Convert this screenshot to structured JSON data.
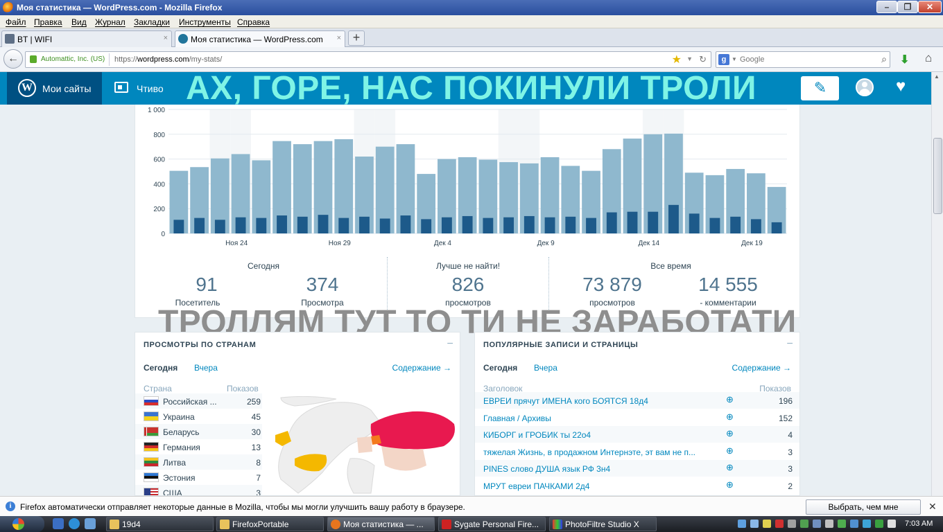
{
  "window": {
    "title": "Моя статистика — WordPress.com - Mozilla Firefox"
  },
  "menu": [
    "Файл",
    "Правка",
    "Вид",
    "Журнал",
    "Закладки",
    "Инструменты",
    "Справка"
  ],
  "tabs": [
    {
      "label": "BT | WIFI",
      "close": "×"
    },
    {
      "label": "Моя статистика — WordPress.com",
      "close": "×"
    }
  ],
  "newtab": "+",
  "address": {
    "identity": "Automattic, Inc. (US)",
    "url_prefix": "https://",
    "url_domain": "wordpress.com",
    "url_path": "/my-stats/"
  },
  "search": {
    "engine": "g",
    "placeholder": "Google"
  },
  "masterbar": {
    "my_sites": "Мои сайты",
    "reader": "Чтиво",
    "banner": "АХ, ГОРЕ, НАС ПОКИНУЛИ ТРОЛИ",
    "accent": "#0087be",
    "banner_color": "#7ff4e6"
  },
  "chart_data": {
    "type": "bar",
    "y_ticks": [
      "1 000",
      "800",
      "600",
      "400",
      "200",
      "0"
    ],
    "ylim": [
      0,
      1000
    ],
    "x_tick_labels": [
      "Ноя 24",
      "Ноя 29",
      "Дек 4",
      "Дек 9",
      "Дек 14",
      "Дек 19"
    ],
    "x_tick_index": [
      4,
      9,
      14,
      19,
      24,
      29
    ],
    "weekend_index": [
      2,
      3,
      9,
      10,
      16,
      17,
      23,
      24
    ],
    "series": [
      {
        "color": "#8fb8ce",
        "values": [
          505,
          535,
          605,
          640,
          590,
          745,
          720,
          745,
          760,
          620,
          700,
          720,
          480,
          600,
          615,
          595,
          575,
          565,
          615,
          545,
          505,
          680,
          765,
          800,
          805,
          490,
          470,
          520,
          485,
          375
        ]
      },
      {
        "color": "#1d5a8a",
        "values": [
          110,
          125,
          110,
          130,
          125,
          145,
          135,
          150,
          125,
          135,
          120,
          145,
          115,
          130,
          140,
          125,
          130,
          140,
          130,
          135,
          125,
          170,
          175,
          175,
          230,
          160,
          125,
          135,
          115,
          90
        ]
      }
    ]
  },
  "summary": {
    "today": {
      "heading": "Сегодня",
      "visitors": "91",
      "visitors_label": "Посетитель",
      "views": "374",
      "views_label": "Просмотра"
    },
    "best": {
      "heading": "Лучше не найти!",
      "views": "826",
      "views_label": "просмотров"
    },
    "all_time": {
      "heading": "Все время",
      "views": "73 879",
      "views_label": "просмотров",
      "comments": "14 555",
      "comments_label": "- комментарии"
    }
  },
  "troll_banner": "ТРОЛЛЯМ ТУТ ТО ТИ НЕ ЗАРАБОТАТИ",
  "countries": {
    "title": "ПРОСМОТРЫ ПО СТРАНАМ",
    "minimize": "–",
    "tab_today": "Сегодня",
    "tab_yesterday": "Вчера",
    "contents": "Содержание →",
    "col_country": "Страна",
    "col_views": "Показов",
    "rows": [
      {
        "name": "Российская ...",
        "views": "259"
      },
      {
        "name": "Украина",
        "views": "45"
      },
      {
        "name": "Беларусь",
        "views": "30"
      },
      {
        "name": "Германия",
        "views": "13"
      },
      {
        "name": "Литва",
        "views": "8"
      },
      {
        "name": "Эстония",
        "views": "7"
      },
      {
        "name": "США",
        "views": "3"
      }
    ]
  },
  "posts": {
    "title": "ПОПУЛЯРНЫЕ ЗАПИСИ И СТРАНИЦЫ",
    "minimize": "–",
    "tab_today": "Сегодня",
    "tab_yesterday": "Вчера",
    "contents": "Содержание →",
    "col_title": "Заголовок",
    "col_views": "Показов",
    "rows": [
      {
        "title": "ЕВРЕИ прячут ИМЕНА кого БОЯТСЯ 18д4",
        "views": "196"
      },
      {
        "title": "Главная / Архивы",
        "views": "152"
      },
      {
        "title": "КИБОРГ и ГРОБИК ты 22о4",
        "views": "4"
      },
      {
        "title": "тяжелая Жизнь, в продажном Интернэте, эт вам не п...",
        "views": "3"
      },
      {
        "title": "PINES слово ДУША язык РФ 3н4",
        "views": "3"
      },
      {
        "title": "МРУТ евреи ПАЧКАМИ 2д4",
        "views": "2"
      }
    ]
  },
  "notification": {
    "message": "Firefox автоматически отправляет некоторые данные в Mozilla, чтобы мы могли улучшить вашу работу в браузере.",
    "button": "Выбрать, чем мне поделиться",
    "close": "✕"
  },
  "taskbar": {
    "items": [
      "19d4",
      "FirefoxPortable",
      "Моя статистика — ...",
      "Sygate Personal Fire...",
      "PhotoFiltre Studio X"
    ],
    "clock": "7:03 AM"
  }
}
